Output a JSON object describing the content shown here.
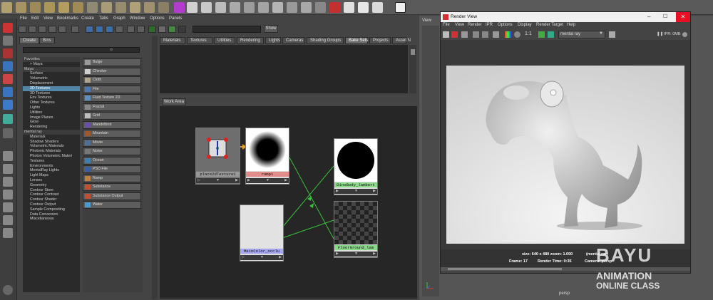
{
  "menubar": {
    "items": [
      "File",
      "Edit",
      "View",
      "Bookmarks",
      "Create",
      "Tabs",
      "Graph",
      "Window",
      "Options",
      "Panels"
    ]
  },
  "toolbar": {
    "show_label": "Show"
  },
  "left_tabs": [
    "Create",
    "Bins"
  ],
  "tree": [
    {
      "label": "Favorites",
      "kind": "hdr"
    },
    {
      "label": "+ Maya",
      "kind": "item"
    },
    {
      "label": "Maya",
      "kind": "hdr"
    },
    {
      "label": "Surface",
      "kind": "item"
    },
    {
      "label": "Volumetric",
      "kind": "item"
    },
    {
      "label": "Displacement",
      "kind": "item"
    },
    {
      "label": "2D Textures",
      "kind": "sel"
    },
    {
      "label": "3D Textures",
      "kind": "item"
    },
    {
      "label": "Env Textures",
      "kind": "item"
    },
    {
      "label": "Other Textures",
      "kind": "item"
    },
    {
      "label": "Lights",
      "kind": "item"
    },
    {
      "label": "Utilities",
      "kind": "item"
    },
    {
      "label": "Image Planes",
      "kind": "item"
    },
    {
      "label": "Glow",
      "kind": "item"
    },
    {
      "label": "Rendering",
      "kind": "item"
    },
    {
      "label": "mental ray",
      "kind": "hdr"
    },
    {
      "label": "Materials",
      "kind": "item"
    },
    {
      "label": "Shadow Shaders",
      "kind": "item"
    },
    {
      "label": "Volumetric Materials",
      "kind": "item"
    },
    {
      "label": "Photonic Materials",
      "kind": "item"
    },
    {
      "label": "Photon Volumetric Materi",
      "kind": "item"
    },
    {
      "label": "Textures",
      "kind": "item"
    },
    {
      "label": "Environments",
      "kind": "item"
    },
    {
      "label": "MentalRay Lights",
      "kind": "item"
    },
    {
      "label": "Light Maps",
      "kind": "item"
    },
    {
      "label": "Lenses",
      "kind": "item"
    },
    {
      "label": "Geometry",
      "kind": "item"
    },
    {
      "label": "Contour Store",
      "kind": "item"
    },
    {
      "label": "Contour Contrast",
      "kind": "item"
    },
    {
      "label": "Contour Shader",
      "kind": "item"
    },
    {
      "label": "Contour Output",
      "kind": "item"
    },
    {
      "label": "Sample Compositing",
      "kind": "item"
    },
    {
      "label": "Data Conversion",
      "kind": "item"
    },
    {
      "label": "Miscellaneous",
      "kind": "item"
    }
  ],
  "node_buttons": [
    {
      "label": "Bulge",
      "color": "#9a9a9a"
    },
    {
      "label": "Checker",
      "color": "#cfcfcf"
    },
    {
      "label": "Cloth",
      "color": "#b0a48a"
    },
    {
      "label": "File",
      "color": "#4a79b5"
    },
    {
      "label": "Fluid Texture 2D",
      "color": "#5d8fc0"
    },
    {
      "label": "Fractal",
      "color": "#888888"
    },
    {
      "label": "Grid",
      "color": "#bdbdbd"
    },
    {
      "label": "Mandelbrot",
      "color": "#6a4fa8"
    },
    {
      "label": "Mountain",
      "color": "#a0572c"
    },
    {
      "label": "Movie",
      "color": "#4d6f9a"
    },
    {
      "label": "Noise",
      "color": "#777777"
    },
    {
      "label": "Ocean",
      "color": "#3c7fb0"
    },
    {
      "label": "PSD File",
      "color": "#3a5fa0"
    },
    {
      "label": "Ramp",
      "color": "#c08040"
    },
    {
      "label": "Substance",
      "color": "#c05030"
    },
    {
      "label": "Substance Output",
      "color": "#c05030"
    },
    {
      "label": "Water",
      "color": "#4a9ad0"
    }
  ],
  "right_tabs": [
    "Materials",
    "Textures",
    "Utilities",
    "Rendering",
    "Lights",
    "Cameras",
    "Shading Groups",
    "Bake Sets",
    "Projects",
    "Asset N"
  ],
  "active_right_tab": "Bake Sets",
  "work_area_label": "Work Area",
  "nodes": {
    "place2d": "place2dTexture1",
    "ramp": "ramp1",
    "occlusion": "MainColor_occlu",
    "dino": "DinoBody_lambert",
    "floor": "FloorGround_lam"
  },
  "render_view": {
    "title": "Render View",
    "menus": [
      "File",
      "View",
      "Render",
      "IPR",
      "Options",
      "Display",
      "Render Target",
      "Help"
    ],
    "renderer": "mental ray",
    "ratio": "1:1",
    "ipr_status": "IPR: 0MB",
    "info_line1": "size: 640 x 480  zoom: 1.000",
    "info_mr": "(mental ray)",
    "frame": "Frame: 17",
    "render_time": "Render Time: 0:35",
    "camera": "Camera: persp"
  },
  "viewport": {
    "view_label": "View",
    "camera_label": "persp"
  },
  "watermark": {
    "line1": "BAYU",
    "line2": "ANIMATION",
    "line3": "ONLINE CLASS"
  },
  "colors": {
    "selected": "#5285a6",
    "active_tab": "#6a6a6a",
    "close_button": "#e81123",
    "node_green": "#8ad88a",
    "node_pink": "#e28b8b",
    "node_purple": "#a6a6ee"
  }
}
